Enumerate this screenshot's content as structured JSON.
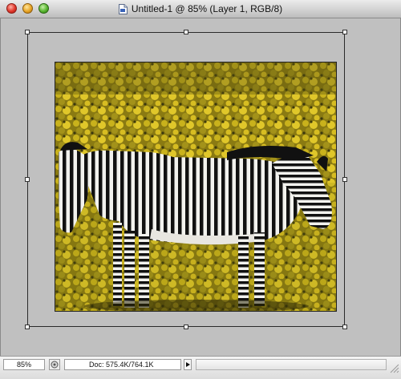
{
  "window": {
    "title": "Untitled-1 @ 85% (Layer 1, RGB/8)",
    "controls": [
      "close",
      "minimize",
      "zoom"
    ]
  },
  "icons": {
    "document": "document-icon",
    "status": "status-icon"
  },
  "status_bar": {
    "zoom": "85%",
    "doc_info": "Doc: 575.4K/764.1K"
  },
  "colors": {
    "canvas_bg": "#c0c0c0",
    "titlebar_top": "#ececec",
    "titlebar_bottom": "#bdbdbd"
  }
}
